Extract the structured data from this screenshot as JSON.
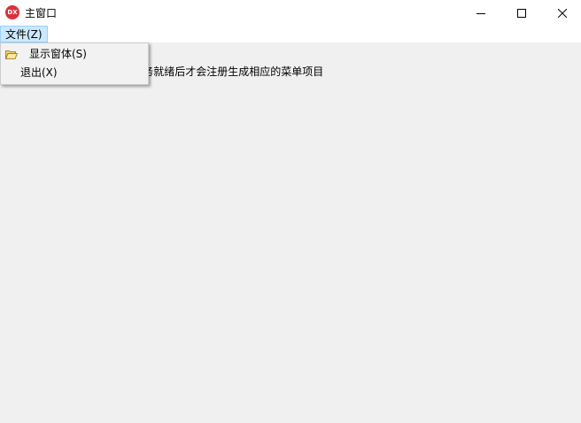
{
  "window": {
    "icon_text": "DX",
    "title": "主窗口"
  },
  "menubar": {
    "file_label": "文件(Z)"
  },
  "file_menu": {
    "items": [
      {
        "label": "显示窗体(S)",
        "icon": "folder-open-icon"
      },
      {
        "label": "退出(X)"
      }
    ]
  },
  "content": {
    "message": "插件会等待IQMenuService服务就绪后才会注册生成相应的菜单项目"
  },
  "colors": {
    "menu_highlight": "#cce8ff",
    "menu_highlight_border": "#99d1ff",
    "app_icon": "#d9313a",
    "client_bg": "#f0f0f0"
  }
}
